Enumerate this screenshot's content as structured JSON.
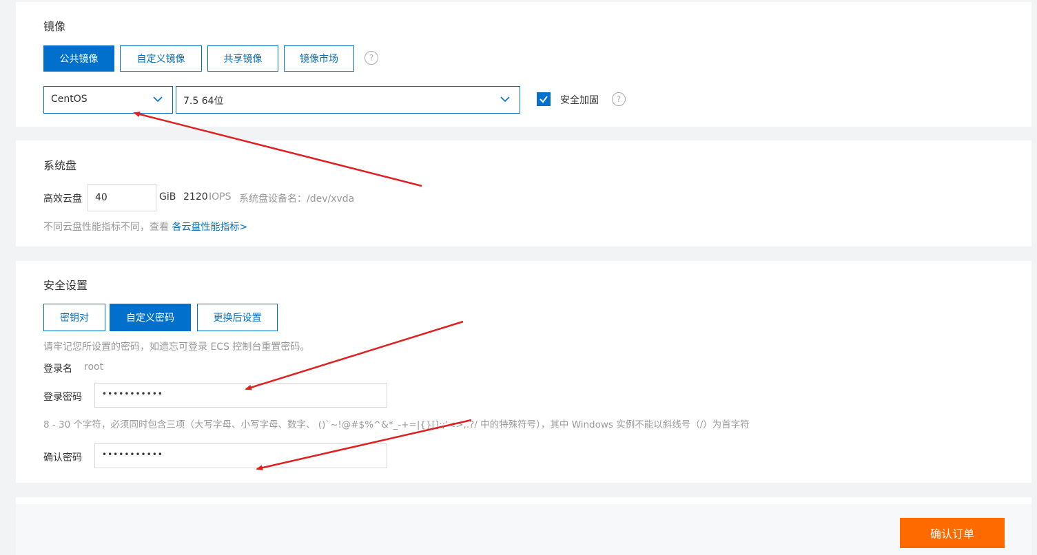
{
  "image_section": {
    "title": "镜像",
    "tabs": [
      {
        "label": "公共镜像",
        "active": true
      },
      {
        "label": "自定义镜像",
        "active": false
      },
      {
        "label": "共享镜像",
        "active": false
      },
      {
        "label": "镜像市场",
        "active": false
      }
    ],
    "help_glyph": "?",
    "os_select": "CentOS",
    "version_select": "7.5 64位",
    "security_harden_label": "安全加固",
    "security_harden_checked": true
  },
  "disk_section": {
    "title": "系统盘",
    "disk_type": "高效云盘",
    "size_value": "40",
    "size_unit": "GiB",
    "iops_value": "2120",
    "iops_unit": "IOPS",
    "device_label": "系统盘设备名：/dev/xvda",
    "note": "不同云盘性能指标不同，查看",
    "note_link": "各云盘性能指标>"
  },
  "security_section": {
    "title": "安全设置",
    "tabs": [
      {
        "label": "密钥对",
        "active": false
      },
      {
        "label": "自定义密码",
        "active": true
      },
      {
        "label": "更换后设置",
        "active": false
      }
    ],
    "hint": "请牢记您所设置的密码，如遗忘可登录 ECS 控制台重置密码。",
    "login_name_label": "登录名",
    "login_name_value": "root",
    "password_label": "登录密码",
    "password_value": "•••••••••••",
    "password_rule": "8 - 30 个字符，必须同时包含三项（大写字母、小写字母、数字、 ()`~!@#$%^&*_-+=|{}[]:;'<>,.?/ 中的特殊符号），其中 Windows 实例不能以斜线号（/）为首字符",
    "confirm_label": "确认密码",
    "confirm_value": "•••••••••••"
  },
  "footer": {
    "confirm_order_label": "确认订单"
  },
  "colors": {
    "primary": "#0070cc",
    "order_button": "#ff6a00",
    "annotation_arrow": "#e02020"
  }
}
